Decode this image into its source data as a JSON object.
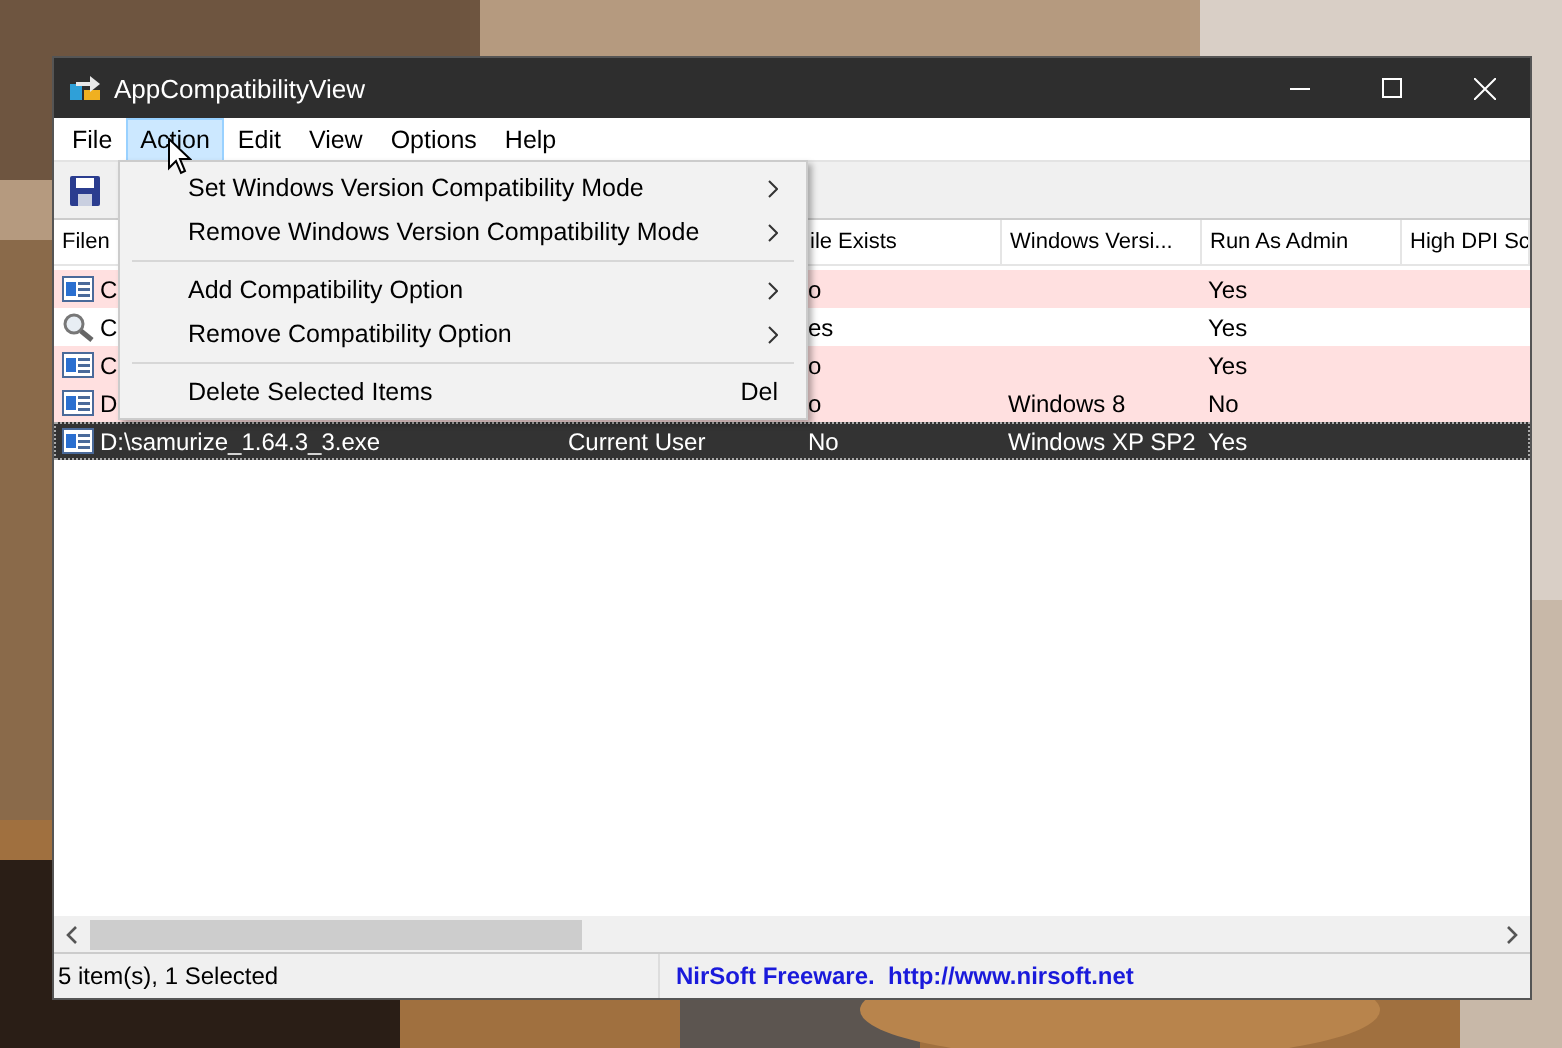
{
  "window": {
    "title": "AppCompatibilityView"
  },
  "menu_bar": [
    {
      "label": "File",
      "selected": false
    },
    {
      "label": "Action",
      "selected": true
    },
    {
      "label": "Edit",
      "selected": false
    },
    {
      "label": "View",
      "selected": false
    },
    {
      "label": "Options",
      "selected": false
    },
    {
      "label": "Help",
      "selected": false
    }
  ],
  "action_menu": {
    "groups": [
      [
        {
          "label": "Set Windows Version Compatibility Mode",
          "submenu": true
        },
        {
          "label": "Remove Windows Version Compatibility Mode",
          "submenu": true
        }
      ],
      [
        {
          "label": "Add Compatibility Option",
          "submenu": true
        },
        {
          "label": "Remove Compatibility Option",
          "submenu": true
        }
      ],
      [
        {
          "label": "Delete Selected Items",
          "submenu": false,
          "shortcut": "Del"
        }
      ]
    ]
  },
  "table": {
    "columns": [
      "Filen",
      "",
      "ile Exists",
      "Windows Versi...",
      "Run As Admin",
      "High DPI Sc"
    ],
    "rows": [
      {
        "kind": "window",
        "color": "#ffe0e0",
        "selected": false,
        "cells": [
          "C",
          "",
          "o",
          "",
          "Yes",
          ""
        ]
      },
      {
        "kind": "magnifier",
        "color": "#ffffff",
        "selected": false,
        "cells": [
          "C",
          "",
          "es",
          "",
          "Yes",
          ""
        ]
      },
      {
        "kind": "window",
        "color": "#ffe0e0",
        "selected": false,
        "cells": [
          "C",
          "",
          "o",
          "",
          "Yes",
          ""
        ]
      },
      {
        "kind": "window",
        "color": "#ffe0e0",
        "selected": false,
        "cells": [
          "D",
          "",
          "o",
          "Windows 8",
          "No",
          ""
        ]
      },
      {
        "kind": "window",
        "selected": true,
        "cells": [
          "D:\\samurize_1.64.3_3.exe",
          "Current User",
          "No",
          "Windows XP SP2",
          "Yes",
          ""
        ]
      }
    ]
  },
  "status_bar": {
    "count": "5 item(s), 1 Selected",
    "link": "NirSoft Freeware.  http://www.nirsoft.net"
  }
}
